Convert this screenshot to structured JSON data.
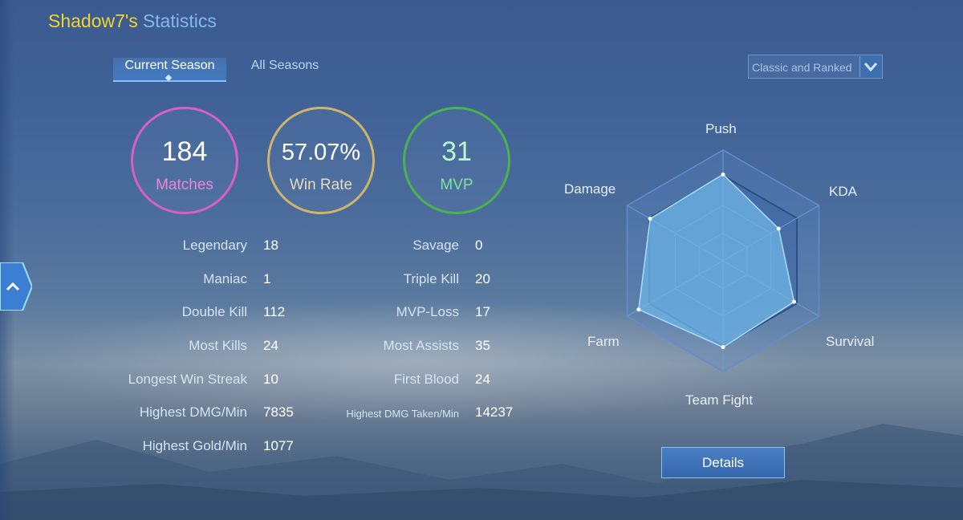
{
  "header": {
    "player_name": "Shadow7's",
    "title_rest": "Statistics"
  },
  "tabs": [
    {
      "label": "Current Season",
      "active": true
    },
    {
      "label": "All Seasons",
      "active": false
    }
  ],
  "mode_filter": {
    "selected": "Classic and Ranked",
    "icon": "chevron-down-icon"
  },
  "summary": {
    "matches": {
      "value": "184",
      "label": "Matches",
      "color": "#d85fc3"
    },
    "win_rate": {
      "value": "57.07%",
      "label": "Win Rate",
      "color": "#cfb46a"
    },
    "mvp": {
      "value": "31",
      "label": "MVP",
      "color": "#4ab24f"
    }
  },
  "stats_left": [
    {
      "label": "Legendary",
      "value": "18"
    },
    {
      "label": "Maniac",
      "value": "1"
    },
    {
      "label": "Double Kill",
      "value": "112"
    },
    {
      "label": "Most Kills",
      "value": "24"
    },
    {
      "label": "Longest Win Streak",
      "value": "10"
    },
    {
      "label": "Highest DMG/Min",
      "value": "7835"
    },
    {
      "label": "Highest Gold/Min",
      "value": "1077"
    }
  ],
  "stats_right": [
    {
      "label": "Savage",
      "value": "0"
    },
    {
      "label": "Triple Kill",
      "value": "20"
    },
    {
      "label": "MVP-Loss",
      "value": "17"
    },
    {
      "label": "Most Assists",
      "value": "35"
    },
    {
      "label": "First Blood",
      "value": "24"
    },
    {
      "label": "Highest DMG Taken/Min",
      "value": "14237"
    }
  ],
  "radar": {
    "axes": [
      "Push",
      "KDA",
      "Survival",
      "Team Fight",
      "Farm",
      "Damage"
    ],
    "values": [
      0.78,
      0.58,
      0.74,
      0.78,
      0.88,
      0.76
    ],
    "fill_color": "#6fb6e6"
  },
  "details_button": {
    "label": "Details"
  }
}
